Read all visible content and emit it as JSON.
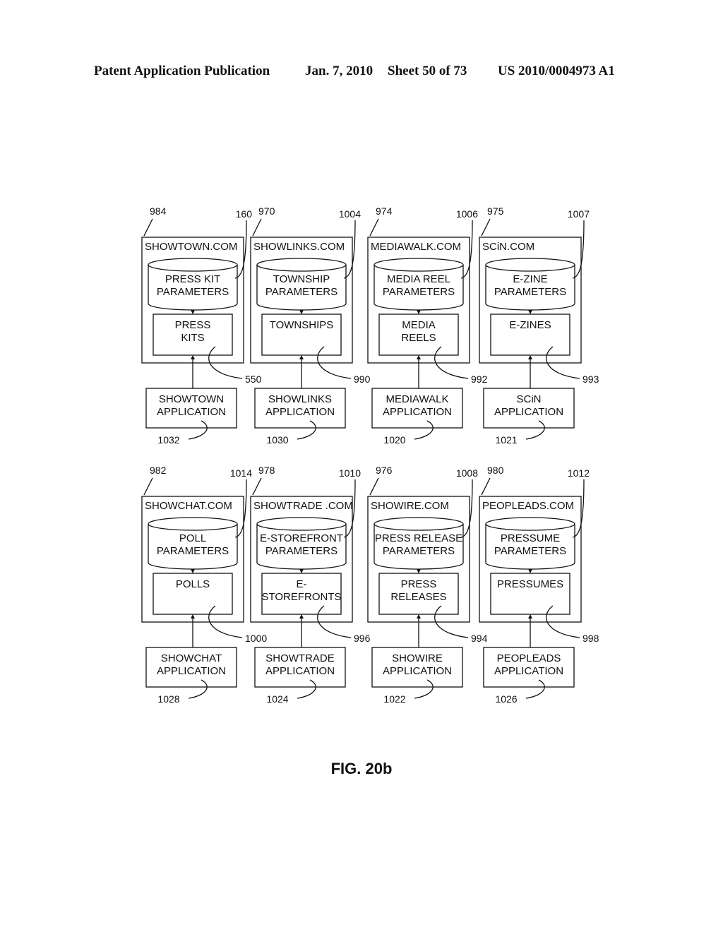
{
  "header": {
    "publication": "Patent Application Publication",
    "date": "Jan. 7, 2010",
    "sheet": "Sheet 50 of 73",
    "number": "US 2010/0004973 A1"
  },
  "caption": "FIG. 20b",
  "sites": [
    {
      "ref": "984",
      "site": "SHOWTOWN.COM",
      "db_ref": "160",
      "db": [
        "PRESS KIT",
        "PARAMETERS"
      ],
      "item_ref": "550",
      "item": [
        "PRESS",
        "KITS"
      ],
      "app_ref": "1032",
      "app": [
        "SHOWTOWN",
        "APPLICATION"
      ]
    },
    {
      "ref": "970",
      "site": "SHOWLINKS.COM",
      "db_ref": "1004",
      "db": [
        "TOWNSHIP",
        "PARAMETERS"
      ],
      "item_ref": "990",
      "item": [
        "TOWNSHIPS"
      ],
      "app_ref": "1030",
      "app": [
        "SHOWLINKS",
        "APPLICATION"
      ]
    },
    {
      "ref": "974",
      "site": "MEDIAWALK.COM",
      "db_ref": "1006",
      "db": [
        "MEDIA REEL",
        "PARAMETERS"
      ],
      "item_ref": "992",
      "item": [
        "MEDIA",
        "REELS"
      ],
      "app_ref": "1020",
      "app": [
        "MEDIAWALK",
        "APPLICATION"
      ]
    },
    {
      "ref": "975",
      "site": "SCiN.COM",
      "db_ref": "1007",
      "db": [
        "E-ZINE",
        "PARAMETERS"
      ],
      "item_ref": "993",
      "item": [
        "E-ZINES"
      ],
      "app_ref": "1021",
      "app": [
        "SCiN",
        "APPLICATION"
      ]
    },
    {
      "ref": "982",
      "site": "SHOWCHAT.COM",
      "db_ref": "1014",
      "db": [
        "POLL",
        "PARAMETERS"
      ],
      "item_ref": "1000",
      "item": [
        "POLLS"
      ],
      "app_ref": "1028",
      "app": [
        "SHOWCHAT",
        "APPLICATION"
      ]
    },
    {
      "ref": "978",
      "site": "SHOWTRADE .COM",
      "db_ref": "1010",
      "db": [
        "E-STOREFRONT",
        "PARAMETERS"
      ],
      "item_ref": "996",
      "item": [
        "E-",
        "STOREFRONTS"
      ],
      "app_ref": "1024",
      "app": [
        "SHOWTRADE",
        "APPLICATION"
      ]
    },
    {
      "ref": "976",
      "site": "SHOWIRE.COM",
      "db_ref": "1008",
      "db": [
        "PRESS RELEASE",
        "PARAMETERS"
      ],
      "item_ref": "994",
      "item": [
        "PRESS",
        "RELEASES"
      ],
      "app_ref": "1022",
      "app": [
        "SHOWIRE",
        "APPLICATION"
      ]
    },
    {
      "ref": "980",
      "site": "PEOPLEADS.COM",
      "db_ref": "1012",
      "db": [
        "PRESSUME",
        "PARAMETERS"
      ],
      "item_ref": "998",
      "item": [
        "PRESSUMES"
      ],
      "app_ref": "1026",
      "app": [
        "PEOPLEADS",
        "APPLICATION"
      ]
    }
  ]
}
